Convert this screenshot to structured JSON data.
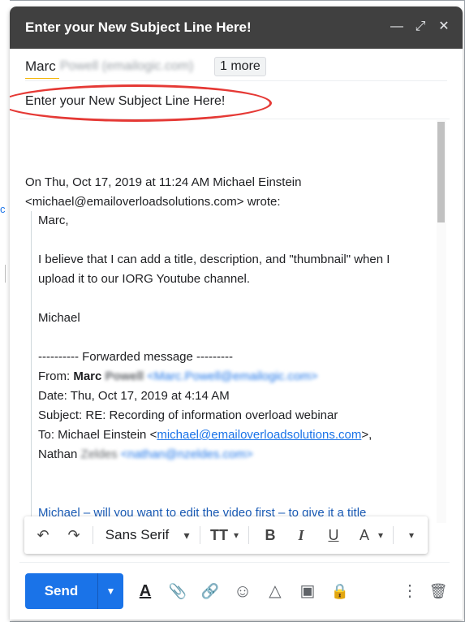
{
  "window": {
    "title": "Enter your New Subject Line Here!",
    "controls": {
      "minimize": "—",
      "expand": "⤢",
      "close": "✕"
    }
  },
  "recipients": {
    "name": "Marc",
    "blurred_rest": "Powell (emailogic.com)",
    "more_label": "1 more"
  },
  "subject": "Enter your New Subject Line Here!",
  "message": {
    "header_line1": "On Thu, Oct 17, 2019 at 11:24 AM Michael Einstein",
    "header_line2": "<michael@emailoverloadsolutions.com> wrote:",
    "greeting": "Marc,",
    "para1_line1": "I believe that I can add a title, description, and \"thumbnail\" when I",
    "para1_line2": "upload it to our IORG Youtube channel.",
    "signature": "Michael",
    "forwarded_header": "---------- Forwarded message ---------",
    "from_label": "From: ",
    "from_first": "Marc",
    "from_last_blurred": "Powell",
    "from_email_blurred": "<Marc.Powell@emailogic.com>",
    "date_line": "Date: Thu, Oct 17, 2019 at 4:14 AM",
    "subject_line": "Subject: RE: Recording of information overload webinar",
    "to_label": "To: Michael Einstein <",
    "to_email": "michael@emailoverloadsolutions.com",
    "to_tail": ">,",
    "nathan_first": "Nathan",
    "nathan_last_blurred": "Zeldes",
    "nathan_email_blurred": "<nathan@nzeldes.com>",
    "quoted_blue": "Michael – will you want to edit the video first – to give it a title"
  },
  "formatting": {
    "undo": "↶",
    "redo": "↷",
    "font": "Sans Serif",
    "font_arrow": "▾",
    "size": "TT",
    "bold": "B",
    "italic": "I",
    "underline": "U",
    "text_color": "A",
    "more": "▾"
  },
  "actions": {
    "send_label": "Send",
    "send_options": "▼",
    "format_toggle": "A",
    "attach": "📎",
    "link": "🔗",
    "emoji": "☺",
    "drive": "△",
    "photo": "▣",
    "confidential": "🔒",
    "more_options": "⋮",
    "discard": "🗑"
  },
  "colors": {
    "titlebar": "#404040",
    "send_blue": "#1a73e8",
    "highlight_red": "#e53935"
  }
}
